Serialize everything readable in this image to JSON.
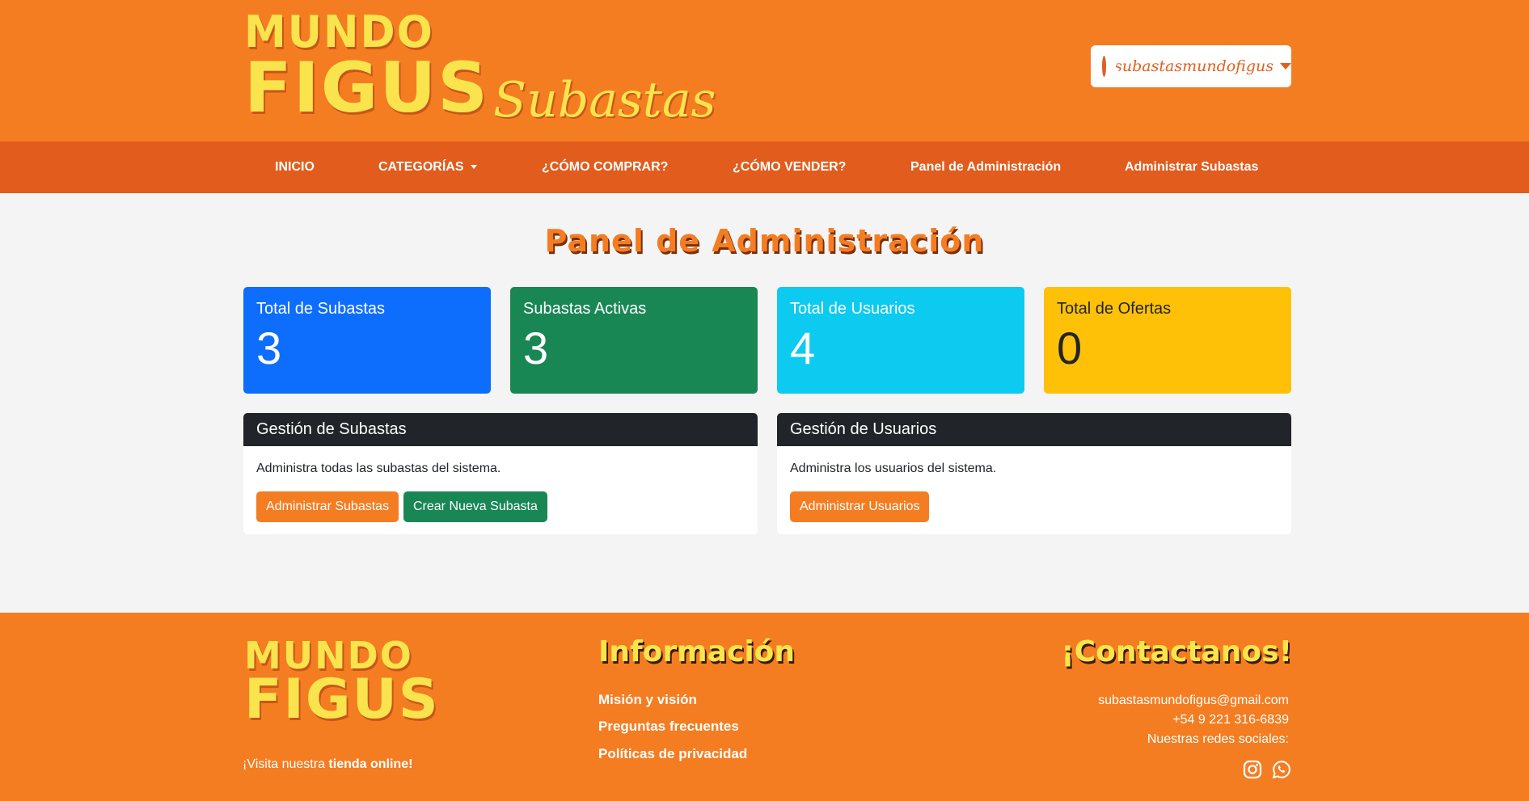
{
  "header": {
    "logo_line1": "MUNDO",
    "logo_line2": "FIGUS",
    "logo_sub": "Subastas",
    "username": "subastasmundofigus",
    "user_icon": "user-circle-icon"
  },
  "nav": {
    "items": [
      {
        "label": "INICIO"
      },
      {
        "label": "CATEGORÍAS",
        "dropdown": true
      },
      {
        "label": "¿CÓMO COMPRAR?"
      },
      {
        "label": "¿CÓMO VENDER?"
      },
      {
        "label": "Panel de Administración"
      },
      {
        "label": "Administrar Subastas"
      }
    ]
  },
  "main": {
    "title": "Panel de Administración",
    "stats": [
      {
        "title": "Total de Subastas",
        "value": "3",
        "color": "#0d6efd"
      },
      {
        "title": "Subastas Activas",
        "value": "3",
        "color": "#198754"
      },
      {
        "title": "Total de Usuarios",
        "value": "4",
        "color": "#0dcaf0"
      },
      {
        "title": "Total de Ofertas",
        "value": "0",
        "color": "#ffc107"
      }
    ],
    "panels": {
      "auctions": {
        "title": "Gestión de Subastas",
        "description": "Administra todas las subastas del sistema.",
        "manage_button": "Administrar Subastas",
        "create_button": "Crear Nueva Subasta"
      },
      "users": {
        "title": "Gestión de Usuarios",
        "description": "Administra los usuarios del sistema.",
        "manage_button": "Administrar Usuarios"
      }
    }
  },
  "footer": {
    "logo_line1": "MUNDO",
    "logo_line2": "FIGUS",
    "visit_prefix": "¡Visita nuestra ",
    "visit_link": "tienda online!",
    "info_title": "Información",
    "info_links": [
      "Misión y visión",
      "Preguntas frecuentes",
      "Políticas de privacidad"
    ],
    "contact_title": "¡Contactanos!",
    "email": "subastasmundofigus@gmail.com",
    "phone": "+54 9 221 316-6839",
    "social_label": "Nuestras redes sociales:",
    "social_icons": [
      "instagram-icon",
      "whatsapp-icon"
    ]
  },
  "colors": {
    "brand_orange": "#f47d22",
    "nav_orange": "#e15c1d",
    "logo_yellow": "#f9e44d",
    "dark": "#212529",
    "button_orange": "#f47d22",
    "button_green": "#198754"
  }
}
